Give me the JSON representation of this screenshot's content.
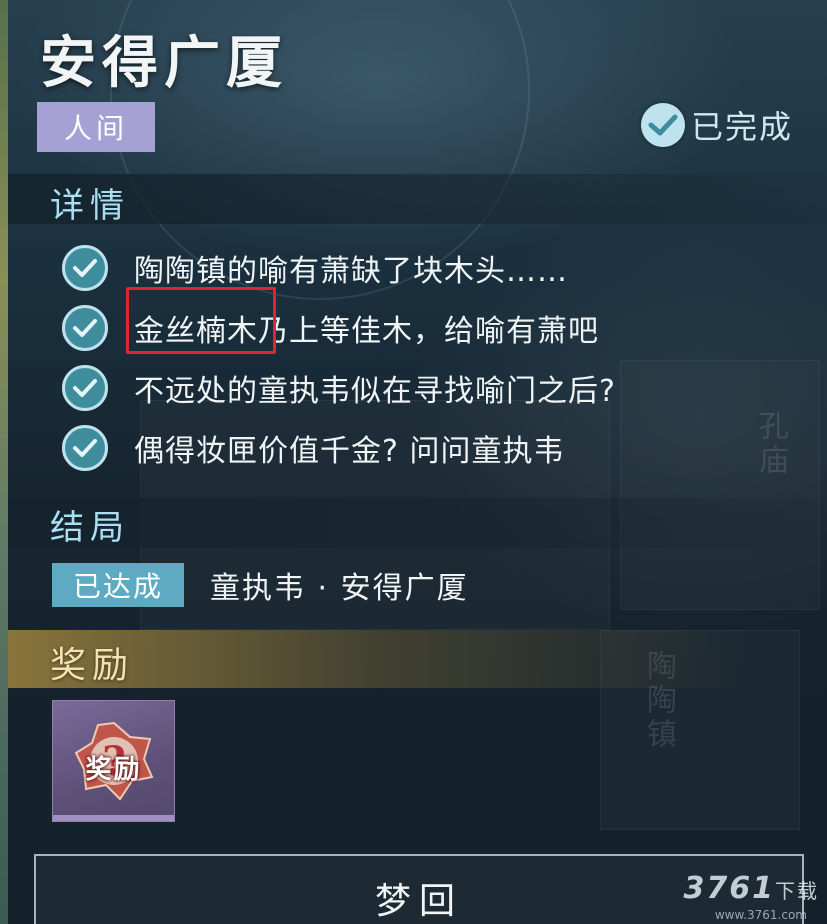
{
  "quest": {
    "title": "安得广厦",
    "realm_tag": "人间",
    "status_label": "已完成"
  },
  "details": {
    "heading": "详情",
    "tasks": [
      {
        "text": "陶陶镇的喻有萧缺了块木头……",
        "done": true
      },
      {
        "text": "金丝楠木乃上等佳木，给喻有萧吧",
        "done": true
      },
      {
        "text": "不远处的童执韦似在寻找喻门之后?",
        "done": true
      },
      {
        "text": "偶得妆匣价值千金? 问问童执韦",
        "done": true
      }
    ]
  },
  "ending": {
    "heading": "结局",
    "badge": "已达成",
    "text": "童执韦 · 安得广厦"
  },
  "reward": {
    "heading": "奖励",
    "item_label": "奖励"
  },
  "actions": {
    "dream_button": "梦回"
  },
  "watermark": {
    "brand": "3761",
    "suffix": "下载",
    "url": "www.3761.com"
  },
  "colors": {
    "realm_tag": "#a6a1d4",
    "section_title": "#a9dff0",
    "check_fill": "#3f8c9d",
    "ending_badge": "#5eaac2",
    "highlight_box": "#e22430",
    "reward_title": "#f4e3b0"
  },
  "icons": {
    "status": "check-circle-icon",
    "task": "check-circle-icon",
    "reward": "mystery-reward-icon"
  }
}
